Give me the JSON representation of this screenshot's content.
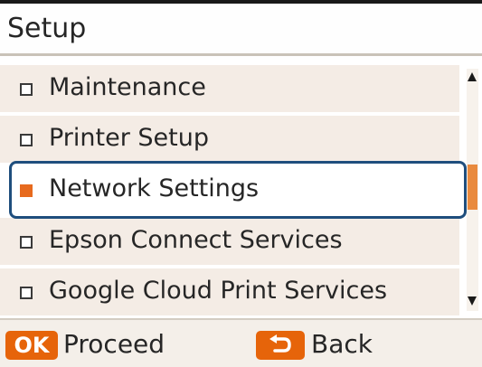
{
  "header": {
    "title": "Setup"
  },
  "menu": {
    "items": [
      {
        "label": "Maintenance",
        "selected": false
      },
      {
        "label": "Printer Setup",
        "selected": false
      },
      {
        "label": "Network Settings",
        "selected": true
      },
      {
        "label": "Epson Connect Services",
        "selected": false
      },
      {
        "label": "Google Cloud Print Services",
        "selected": false
      }
    ]
  },
  "scrollbar": {
    "up_icon": "arrow-up-icon",
    "down_icon": "arrow-down-icon",
    "thumb_color": "#e98a3e"
  },
  "footer": {
    "ok_key": "OK",
    "proceed_label": "Proceed",
    "back_icon": "back-return-icon",
    "back_label": "Back"
  },
  "colors": {
    "accent": "#e6640a",
    "selection_frame": "#1f4e7d",
    "row_background": "#f4ece5"
  }
}
